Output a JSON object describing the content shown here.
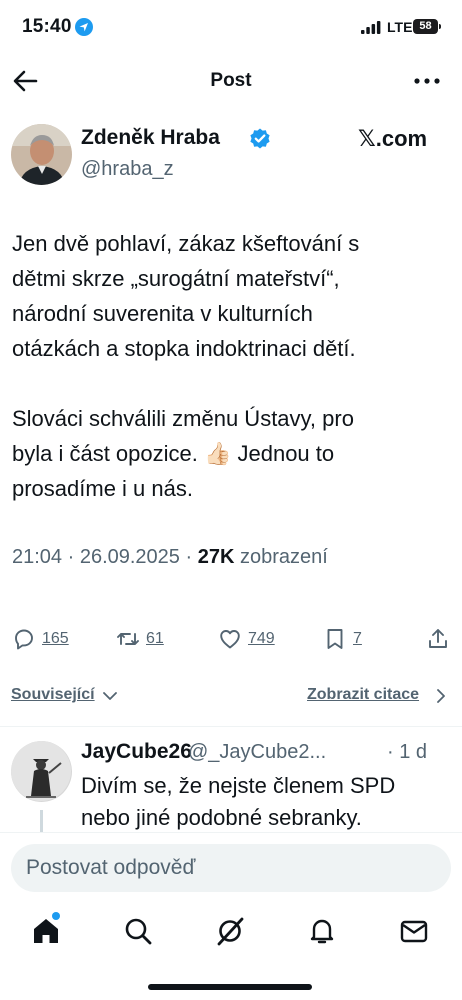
{
  "status_bar": {
    "time": "15:40",
    "network": "LTE",
    "battery": "58"
  },
  "nav": {
    "title": "Post"
  },
  "post": {
    "author_name": "Zdeněk Hraba",
    "author_handle": "@hraba_z",
    "source": "𝕏.com",
    "paragraphs": [
      "Jen dvě pohlaví, zákaz kšeftování s\ndětmi skrze „surogátní mateřství“,\nnárodní suverenita v kulturních\notázkách a stopka indoktrinaci dětí.",
      "Slováci schválili změnu Ústavy, pro\nbyla i část opozice. 👍🏻 Jednou to\nprosadíme i u nás."
    ],
    "timestamp": "21:04 · 26.09.2025 · ",
    "views_count": "27K",
    "views_label": " zobrazení"
  },
  "actions": {
    "replies": "165",
    "reposts": "61",
    "likes": "749",
    "bookmarks": "7"
  },
  "related": {
    "left_label": "Související",
    "right_label": "Zobrazit citace"
  },
  "reply": {
    "name": "JayCube26",
    "handle": "@_JayCube2...",
    "time": "· 1 d",
    "text": "Divím se, že nejste členem SPD\nnebo jiné podobné sebranky."
  },
  "composer": {
    "placeholder": "Postovat odpověď"
  },
  "colors": {
    "accent": "#1d9bf0",
    "secondary_text": "#536471",
    "primary_text": "#0f1419"
  },
  "icons": {
    "status": [
      "location-arrow-icon",
      "signal-icon",
      "battery-icon"
    ],
    "nav": [
      "back-arrow-icon",
      "more-icon"
    ],
    "actions": [
      "reply-icon",
      "repost-icon",
      "like-icon",
      "bookmark-icon",
      "share-icon"
    ],
    "tabs": [
      "home-icon",
      "search-icon",
      "grok-icon",
      "notifications-icon",
      "messages-icon"
    ]
  }
}
